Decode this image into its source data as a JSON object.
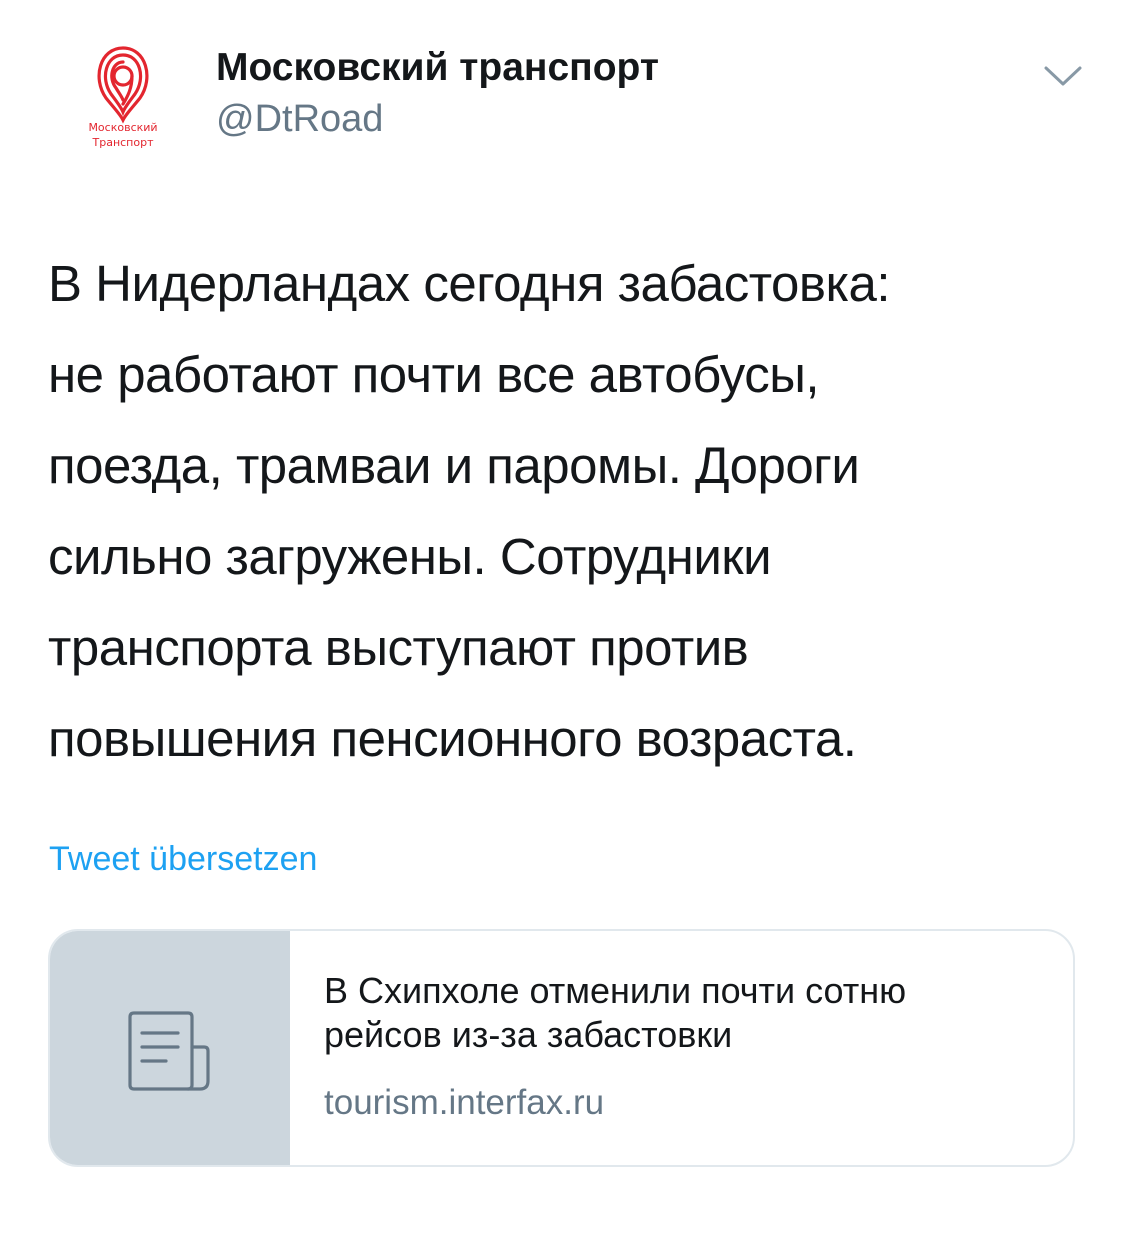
{
  "author": {
    "name": "Московский транспорт",
    "handle": "@DtRoad",
    "logo_text_line1": "Московский",
    "logo_text_line2": "Транспорт"
  },
  "icons": {
    "caret": "chevron-down-icon",
    "card": "document-icon"
  },
  "tweet": {
    "lines": [
      "В Нидерландах сегодня забастовка:",
      "не работают почти все автобусы,",
      "поезда, трамваи и паромы. Дороги",
      "сильно загружены. Сотрудники",
      "транспорта выступают против",
      "повышения пенсионного возраста."
    ],
    "translate_label": "Tweet übersetzen"
  },
  "card": {
    "title_lines": [
      "В Схипхоле отменили почти сотню",
      "рейсов из-за забастовки"
    ],
    "domain": "tourism.interfax.ru"
  },
  "colors": {
    "link": "#1da1f2",
    "secondary_text": "#657786",
    "brand_red": "#e3262f",
    "card_thumb_bg": "#ccd6dd",
    "card_border": "#e1e8ed"
  }
}
